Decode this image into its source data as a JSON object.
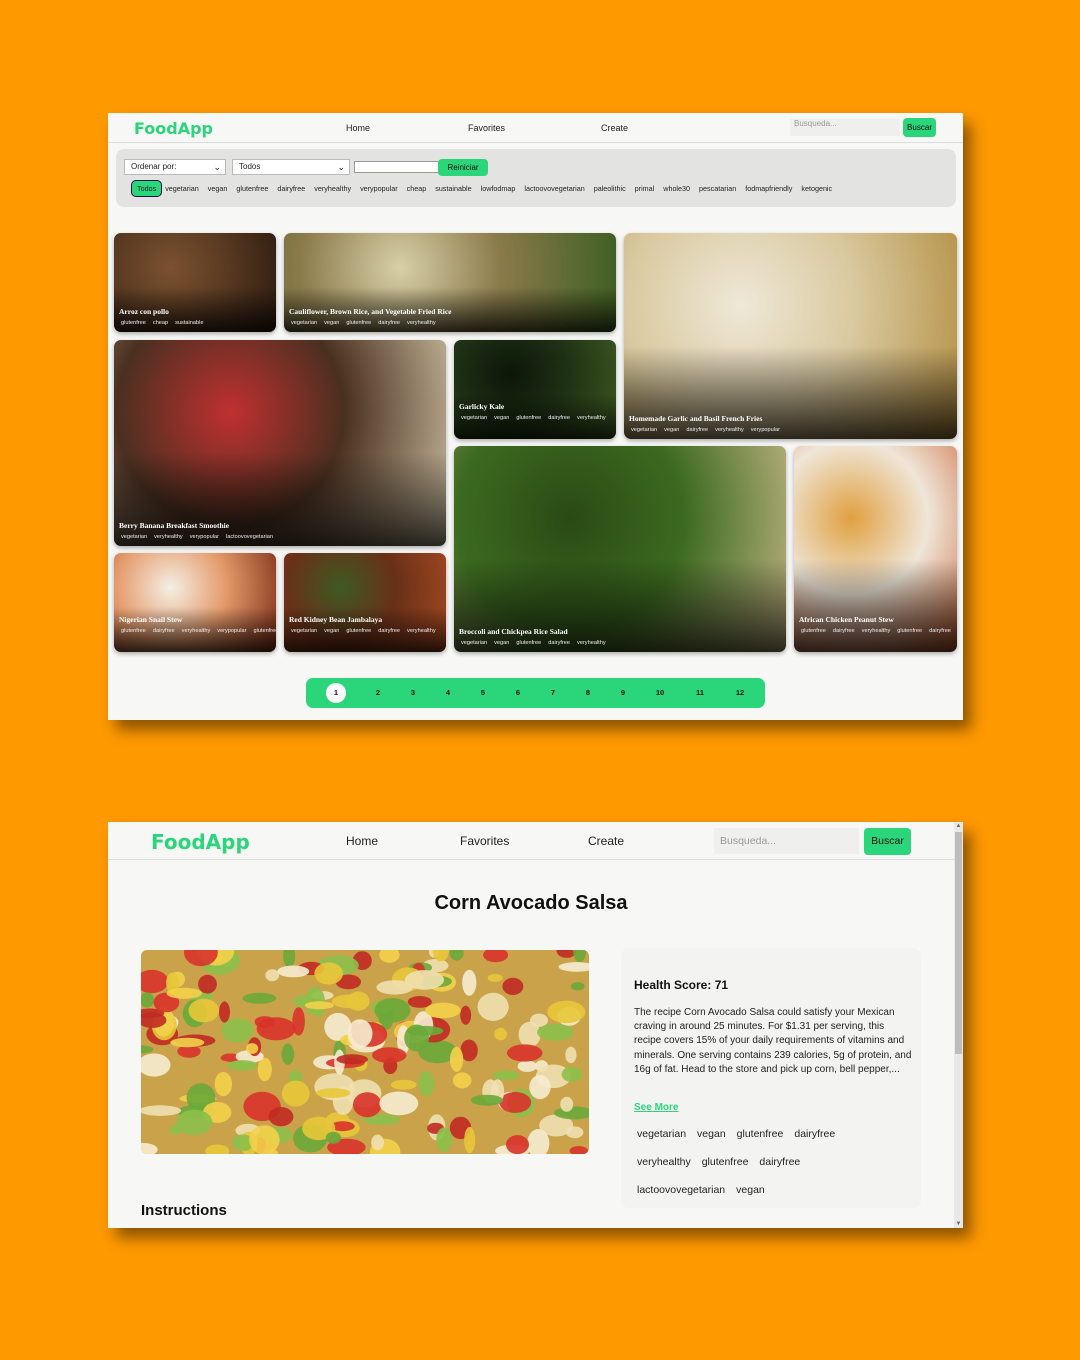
{
  "brand": {
    "name": "FoodApp"
  },
  "nav": {
    "home": "Home",
    "favorites": "Favorites",
    "create": "Create"
  },
  "search": {
    "placeholder": "Busqueda...",
    "button": "Buscar"
  },
  "filters": {
    "sort_label": "Ordenar por:",
    "type_value": "Todos",
    "reset": "Reiniciar",
    "diets": [
      "Todos",
      "vegetarian",
      "vegan",
      "glutenfree",
      "dairyfree",
      "veryhealthy",
      "verypopular",
      "cheap",
      "sustainable",
      "lowfodmap",
      "lactoovovegetarian",
      "paleolithic",
      "primal",
      "whole30",
      "pescatarian",
      "fodmapfriendly",
      "ketogenic"
    ]
  },
  "recipes": [
    {
      "title": "Arroz con pollo",
      "tags": [
        "glutenfree",
        "cheap",
        "sustainable"
      ]
    },
    {
      "title": "Cauliflower, Brown Rice, and Vegetable Fried Rice",
      "tags": [
        "vegetarian",
        "vegan",
        "glutenfree",
        "dairyfree",
        "veryhealthy"
      ]
    },
    {
      "title": "Homemade Garlic and Basil French Fries",
      "tags": [
        "vegetarian",
        "vegan",
        "dairyfree",
        "veryhealthy",
        "verypopular"
      ]
    },
    {
      "title": "Berry Banana Breakfast Smoothie",
      "tags": [
        "vegetarian",
        "veryhealthy",
        "verypopular",
        "lactoovovegetarian"
      ]
    },
    {
      "title": "Garlicky Kale",
      "tags": [
        "vegetarian",
        "vegan",
        "glutenfree",
        "dairyfree",
        "veryhealthy"
      ]
    },
    {
      "title": "Nigerian Snail Stew",
      "tags": [
        "glutenfree",
        "dairyfree",
        "veryhealthy",
        "verypopular",
        "glutenfree"
      ]
    },
    {
      "title": "Red Kidney Bean Jambalaya",
      "tags": [
        "vegetarian",
        "vegan",
        "glutenfree",
        "dairyfree",
        "veryhealthy"
      ]
    },
    {
      "title": "Broccoli and Chickpea Rice Salad",
      "tags": [
        "vegetarian",
        "vegan",
        "glutenfree",
        "dairyfree",
        "veryhealthy"
      ]
    },
    {
      "title": "African Chicken Peanut Stew",
      "tags": [
        "glutenfree",
        "dairyfree",
        "veryhealthy",
        "glutenfree",
        "dairyfree"
      ]
    }
  ],
  "pagination": {
    "pages": [
      "1",
      "2",
      "3",
      "4",
      "5",
      "6",
      "7",
      "8",
      "9",
      "10",
      "11",
      "12"
    ],
    "current": "1"
  },
  "detail": {
    "title": "Corn Avocado Salsa",
    "health_score": "Health Score: 71",
    "summary": "The recipe Corn Avocado Salsa could satisfy your Mexican craving in around 25 minutes. For $1.31 per serving, this recipe covers 15% of your daily requirements of vitamins and minerals. One serving contains 239 calories, 5g of protein, and 16g of fat. Head to the store and pick up corn, bell pepper,...",
    "see_more": "See More",
    "tag_rows": [
      [
        "vegetarian",
        "vegan",
        "glutenfree",
        "dairyfree"
      ],
      [
        "veryhealthy",
        "glutenfree",
        "dairyfree"
      ],
      [
        "lactoovovegetarian",
        "vegan"
      ]
    ],
    "instructions_heading": "Instructions"
  },
  "colors": {
    "background": "#FF9900",
    "accent": "#2bd67b",
    "page": "#f7f7f5"
  }
}
